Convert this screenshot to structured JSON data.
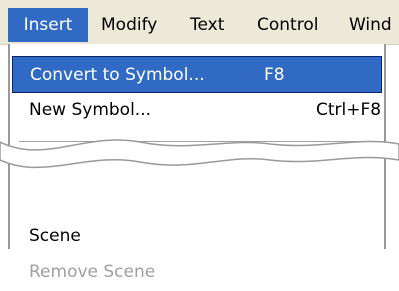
{
  "menubar": {
    "items": [
      "Insert",
      "Modify",
      "Text",
      "Control",
      "Wind"
    ]
  },
  "insert_menu": {
    "convert_to_symbol": {
      "label": "Convert to Symbol...",
      "shortcut": "F8"
    },
    "new_symbol": {
      "label": "New Symbol...",
      "shortcut": "Ctrl+F8"
    },
    "partial_item": ".",
    "scene": {
      "label": "Scene"
    },
    "remove_scene": {
      "label": "Remove Scene"
    }
  },
  "colors": {
    "menubar_bg": "#ece9d8",
    "highlight": "#316ac5",
    "disabled_text": "#a0a0a0"
  }
}
